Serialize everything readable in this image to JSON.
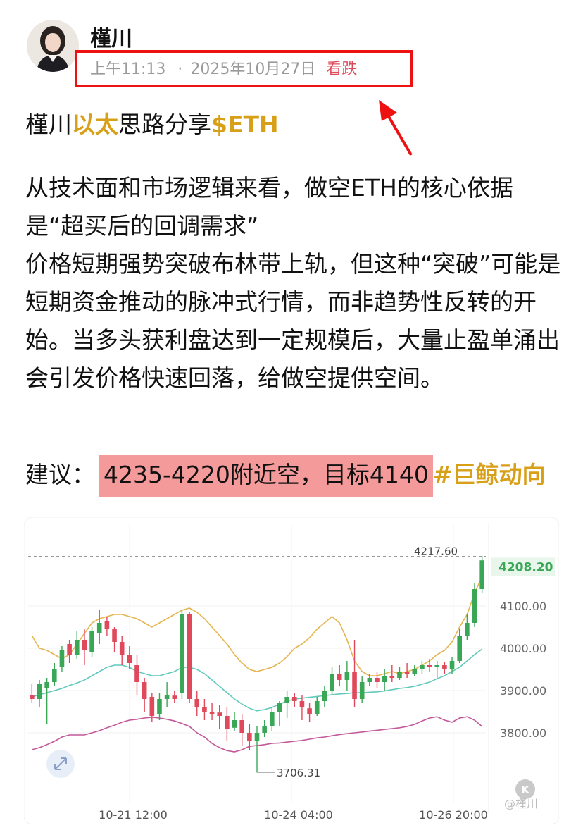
{
  "post": {
    "author": "槿川",
    "time": "上午11:13",
    "date_sep": "·",
    "date": "2025年10月27日",
    "sentiment": "看跌",
    "title_prefix": "槿川",
    "title_highlight": "以太",
    "title_middle": "思路分享",
    "title_ticker": "$ETH",
    "paragraph1": "从技术面和市场逻辑来看，做空ETH的核心依据是“超买后的回调需求”",
    "paragraph2": "价格短期强势突破布林带上轨，但这种“突破”可能是短期资金推动的脉冲式行情，而非趋势性反转的开始。当多头获利盘达到一定规模后，大量止盈单涌出会引发价格快速回落，给做空提供空间。",
    "suggest_label": "建议：",
    "suggest_value": "4235-4220附近空，目标4140",
    "suggest_tag": "#巨鲸动向"
  },
  "chart_data": {
    "type": "candlestick",
    "ylim": [
      3650,
      4260
    ],
    "y_ticks": [
      "4100.00",
      "4000.00",
      "3900.00",
      "3800.00"
    ],
    "x_ticks": [
      "10-21 12:00",
      "10-24 04:00",
      "10-26 20:00"
    ],
    "last_price": "4208.20",
    "high_marker": "4217.60",
    "low_marker": "3706.31",
    "watermark": "@槿川",
    "colors": {
      "up": "#3aa757",
      "down": "#e0495b",
      "upper_band": "#e5b550",
      "middle_band": "#62c9bd",
      "lower_band": "#c2589a",
      "last_price_text": "#3aa757",
      "last_price_bg": "#e9f6ec"
    },
    "candles": [
      [
        3890,
        3880,
        3915,
        3870
      ],
      [
        3880,
        3915,
        3925,
        3860
      ],
      [
        3905,
        3920,
        3930,
        3820
      ],
      [
        3920,
        3950,
        3965,
        3910
      ],
      [
        3955,
        3995,
        4005,
        3945
      ],
      [
        4010,
        3985,
        4020,
        3965
      ],
      [
        3985,
        4020,
        4040,
        3975
      ],
      [
        4020,
        3995,
        4045,
        3960
      ],
      [
        3990,
        4040,
        4050,
        3980
      ],
      [
        4035,
        4060,
        4090,
        4010
      ],
      [
        4065,
        4045,
        4075,
        4030
      ],
      [
        4045,
        4015,
        4050,
        3990
      ],
      [
        4015,
        3985,
        4030,
        3960
      ],
      [
        3985,
        3965,
        4005,
        3950
      ],
      [
        3960,
        3920,
        3985,
        3890
      ],
      [
        3920,
        3880,
        3930,
        3850
      ],
      [
        3885,
        3840,
        3895,
        3825
      ],
      [
        3845,
        3880,
        3895,
        3830
      ],
      [
        3880,
        3890,
        3920,
        3860
      ],
      [
        3888,
        3880,
        3900,
        3870
      ],
      [
        3895,
        4080,
        4090,
        3880
      ],
      [
        4080,
        3880,
        4085,
        3870
      ],
      [
        3880,
        3860,
        3900,
        3840
      ],
      [
        3860,
        3850,
        3880,
        3830
      ],
      [
        3850,
        3845,
        3870,
        3830
      ],
      [
        3848,
        3840,
        3865,
        3810
      ],
      [
        3840,
        3810,
        3860,
        3780
      ],
      [
        3812,
        3830,
        3850,
        3805
      ],
      [
        3830,
        3800,
        3845,
        3770
      ],
      [
        3800,
        3780,
        3820,
        3760
      ],
      [
        3780,
        3800,
        3815,
        3706
      ],
      [
        3800,
        3815,
        3830,
        3790
      ],
      [
        3815,
        3850,
        3860,
        3805
      ],
      [
        3850,
        3870,
        3875,
        3815
      ],
      [
        3870,
        3885,
        3900,
        3835
      ],
      [
        3885,
        3875,
        3895,
        3860
      ],
      [
        3875,
        3860,
        3890,
        3830
      ],
      [
        3858,
        3845,
        3870,
        3825
      ],
      [
        3845,
        3875,
        3885,
        3840
      ],
      [
        3875,
        3900,
        3910,
        3860
      ],
      [
        3900,
        3940,
        3955,
        3890
      ],
      [
        3940,
        3925,
        3960,
        3910
      ],
      [
        3925,
        3945,
        3970,
        3900
      ],
      [
        3945,
        3880,
        4020,
        3860
      ],
      [
        3880,
        3920,
        3935,
        3870
      ],
      [
        3920,
        3930,
        3940,
        3910
      ],
      [
        3930,
        3920,
        3945,
        3905
      ],
      [
        3920,
        3935,
        3950,
        3900
      ],
      [
        3935,
        3930,
        3960,
        3920
      ],
      [
        3930,
        3945,
        3955,
        3925
      ],
      [
        3945,
        3940,
        3965,
        3930
      ],
      [
        3940,
        3950,
        3960,
        3935
      ],
      [
        3950,
        3960,
        3970,
        3940
      ],
      [
        3960,
        3955,
        3975,
        3945
      ],
      [
        3955,
        3960,
        3970,
        3930
      ],
      [
        3960,
        3950,
        3968,
        3940
      ],
      [
        3950,
        3970,
        3980,
        3940
      ],
      [
        3970,
        4030,
        4045,
        3965
      ],
      [
        4030,
        4060,
        4080,
        4020
      ],
      [
        4060,
        4140,
        4155,
        4050
      ],
      [
        4140,
        4208,
        4218,
        4130
      ]
    ],
    "upper_band": [
      4030,
      4000,
      3995,
      3985,
      3975,
      3985,
      4010,
      4035,
      4060,
      4070,
      4075,
      4080,
      4080,
      4075,
      4070,
      4060,
      4050,
      4060,
      4070,
      4080,
      4090,
      4095,
      4085,
      4070,
      4050,
      4030,
      4010,
      3985,
      3965,
      3950,
      3945,
      3950,
      3955,
      3965,
      3980,
      4000,
      4010,
      4025,
      4045,
      4060,
      4075,
      4060,
      4020,
      3970,
      3945,
      3935,
      3935,
      3940,
      3945,
      3940,
      3945,
      3950,
      3960,
      3970,
      3985,
      3995,
      4015,
      4050,
      4080,
      4130,
      4170
    ],
    "middle_band": [
      3885,
      3890,
      3895,
      3900,
      3905,
      3912,
      3918,
      3925,
      3935,
      3945,
      3955,
      3960,
      3960,
      3955,
      3945,
      3940,
      3935,
      3935,
      3940,
      3945,
      3955,
      3955,
      3950,
      3940,
      3925,
      3910,
      3895,
      3880,
      3868,
      3858,
      3852,
      3855,
      3860,
      3868,
      3875,
      3880,
      3882,
      3884,
      3886,
      3888,
      3890,
      3892,
      3893,
      3895,
      3895,
      3896,
      3897,
      3899,
      3902,
      3905,
      3907,
      3910,
      3915,
      3920,
      3928,
      3935,
      3945,
      3955,
      3970,
      3985,
      3998
    ],
    "lower_band": [
      3760,
      3765,
      3772,
      3780,
      3790,
      3795,
      3795,
      3795,
      3800,
      3805,
      3812,
      3818,
      3825,
      3830,
      3832,
      3835,
      3837,
      3835,
      3832,
      3828,
      3822,
      3815,
      3800,
      3790,
      3775,
      3765,
      3758,
      3755,
      3760,
      3768,
      3770,
      3772,
      3775,
      3776,
      3778,
      3780,
      3782,
      3785,
      3788,
      3790,
      3793,
      3796,
      3798,
      3800,
      3802,
      3804,
      3806,
      3808,
      3810,
      3812,
      3815,
      3820,
      3828,
      3835,
      3838,
      3830,
      3825,
      3835,
      3838,
      3830,
      3815
    ]
  }
}
